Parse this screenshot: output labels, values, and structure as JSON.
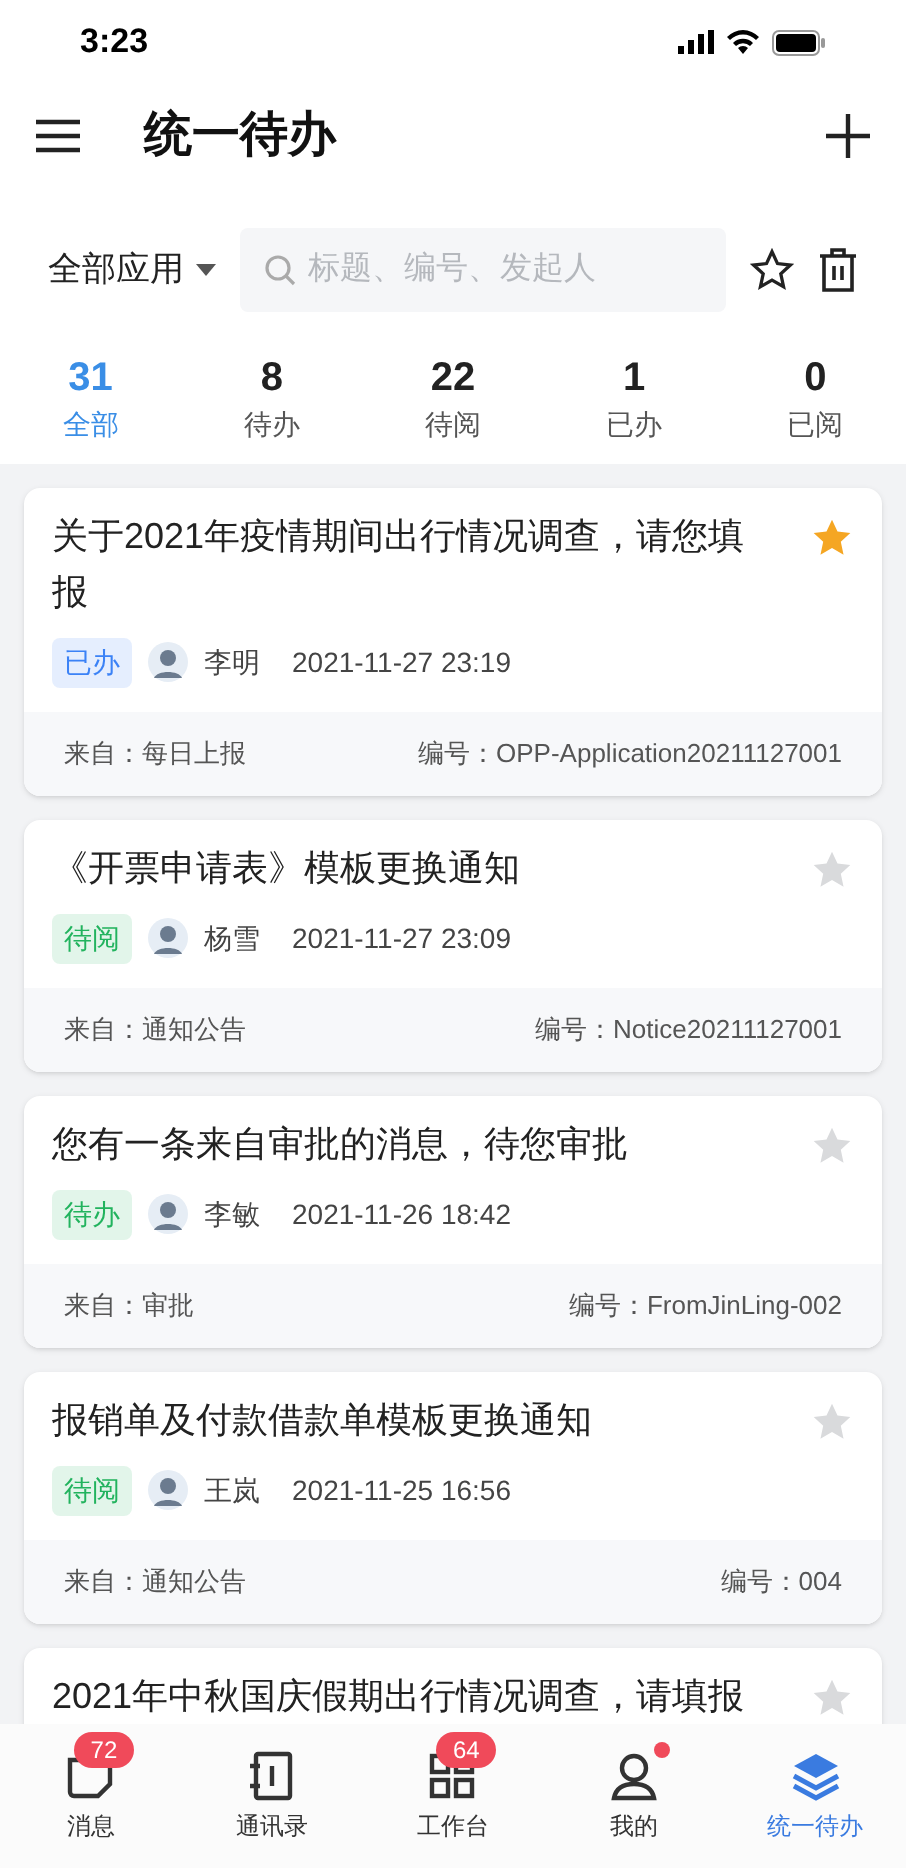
{
  "status_bar": {
    "time": "3:23"
  },
  "header": {
    "title": "统一待办"
  },
  "filter": {
    "app_select": "全部应用",
    "search": {
      "placeholder": "标题、编号、发起人"
    }
  },
  "tabs": [
    {
      "count": "31",
      "label": "全部",
      "selected": true
    },
    {
      "count": "8",
      "label": "待办",
      "selected": false
    },
    {
      "count": "22",
      "label": "待阅",
      "selected": false
    },
    {
      "count": "1",
      "label": "已办",
      "selected": false
    },
    {
      "count": "0",
      "label": "已阅",
      "selected": false
    }
  ],
  "items": [
    {
      "title": "关于2021年疫情期间出行情况调查，请您填报",
      "starred": true,
      "tag": "已办",
      "color": "#3b82f6",
      "person": "李明",
      "time": "2021-11-27 23:19",
      "source": "来自：每日上报",
      "number": "编号：OPP-Application20211127001"
    },
    {
      "title": "《开票申请表》模板更换通知",
      "starred": false,
      "tag": "待阅",
      "color": "#22b35e",
      "person": "杨雪",
      "time": "2021-11-27 23:09",
      "source": "来自：通知公告",
      "number": "编号：Notice20211127001"
    },
    {
      "title": "您有一条来自审批的消息，待您审批",
      "starred": false,
      "tag": "待办",
      "color": "#22b35e",
      "person": "李敏",
      "time": "2021-11-26 18:42",
      "source": "来自：审批",
      "number": "编号：FromJinLing-002"
    },
    {
      "title": "报销单及付款借款单模板更换通知",
      "starred": false,
      "tag": "待阅",
      "color": "#22b35e",
      "person": "王岚",
      "time": "2021-11-25 16:56",
      "source": "来自：通知公告",
      "number": "编号：004"
    },
    {
      "title": "2021年中秋国庆假期出行情况调查，请填报",
      "starred": false
    }
  ],
  "tab_bar": [
    {
      "kind": "chat",
      "label": "消息",
      "badge": "72",
      "dot": false,
      "selected": false
    },
    {
      "kind": "contacts",
      "label": "通讯录",
      "dot": false,
      "selected": false
    },
    {
      "kind": "grid",
      "label": "工作台",
      "badge": "64",
      "dot": false,
      "selected": false
    },
    {
      "kind": "person",
      "label": "我的",
      "dot": true,
      "selected": false
    },
    {
      "kind": "layers",
      "label": "统一待办",
      "dot": false,
      "selected": true
    }
  ]
}
